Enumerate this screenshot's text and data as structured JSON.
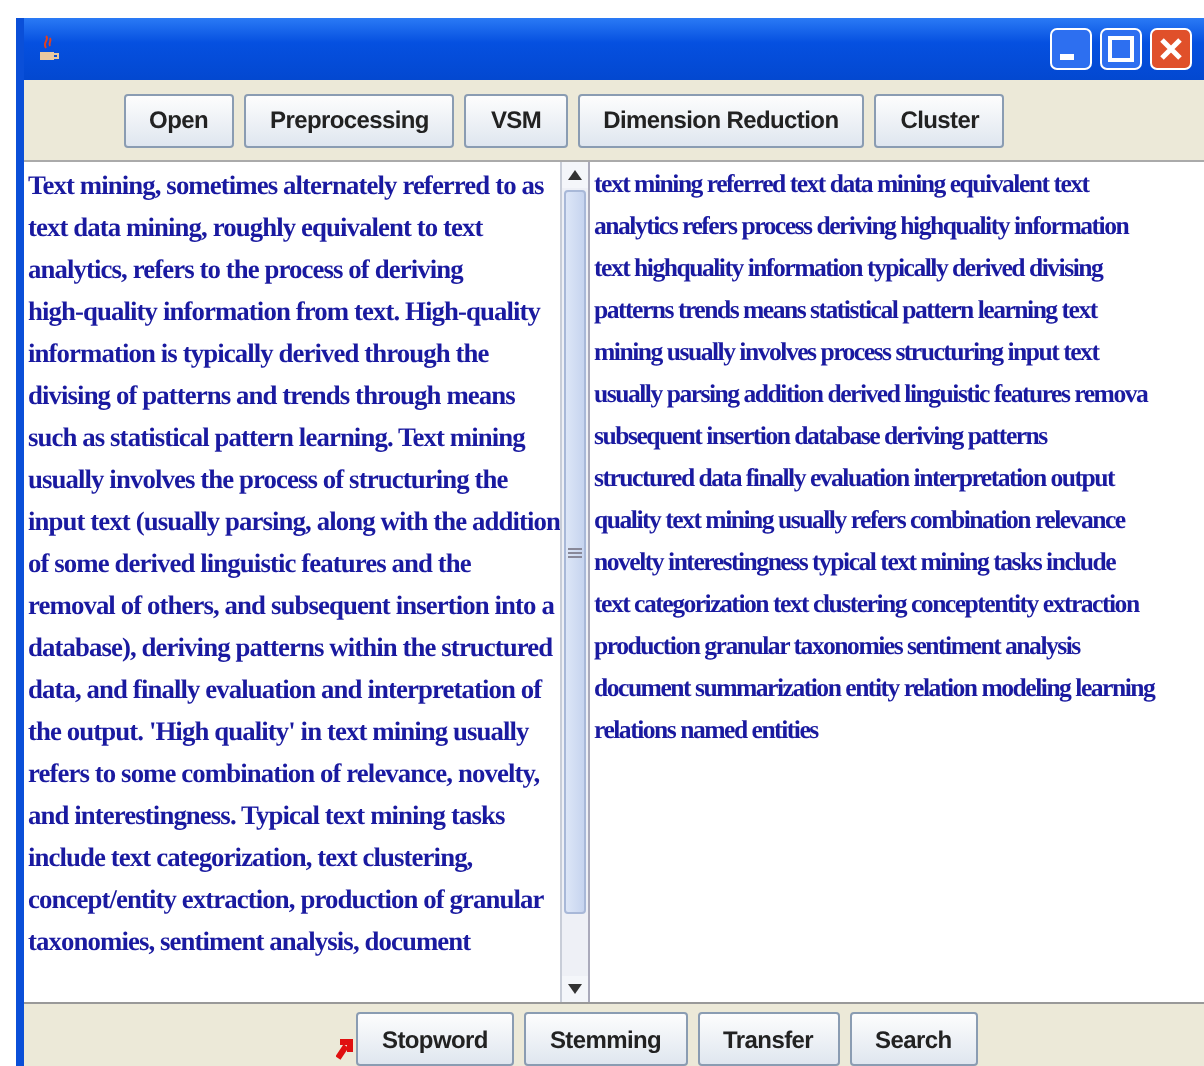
{
  "toolbar": [
    "Open",
    "Preprocessing",
    "VSM",
    "Dimension Reduction",
    "Cluster"
  ],
  "input_text": {
    "lines": [
      "Text mining, sometimes alternately referred to as",
      "text data mining, roughly equivalent to text",
      "analytics, refers to the process of deriving",
      "high-quality information from text. High-quality",
      "information is typically derived through the",
      "divising of patterns and trends through means",
      "such as statistical pattern learning. Text mining",
      "usually involves the process of structuring the",
      "input text (usually parsing, along with the addition",
      "of some derived linguistic features and the",
      "removal of others, and subsequent insertion into a",
      "database), deriving patterns within the structured",
      "data, and finally evaluation and interpretation of",
      "the output. 'High quality' in text mining usually",
      "refers to some combination of relevance, novelty,",
      "and interestingness. Typical text mining tasks",
      "include text categorization, text clustering,",
      "concept/entity extraction, production of granular",
      "taxonomies, sentiment analysis, document"
    ]
  },
  "output_text": {
    "lines": [
      "text mining referred text data mining equivalent text",
      "analytics refers process deriving highquality information",
      "text highquality information typically derived divising",
      "patterns trends means statistical pattern learning text",
      "mining usually involves process structuring input text",
      "usually parsing addition derived linguistic features remova",
      "subsequent insertion database deriving patterns",
      "structured data finally evaluation interpretation output",
      "quality text mining usually refers combination relevance",
      "novelty interestingness typical text mining tasks include",
      "text categorization text clustering conceptentity extraction",
      "production granular taxonomies sentiment analysis",
      "document summarization entity relation modeling learning",
      "relations named entities"
    ]
  },
  "bottom_buttons": [
    "Stopword",
    "Stemming",
    "Transfer",
    "Search"
  ]
}
